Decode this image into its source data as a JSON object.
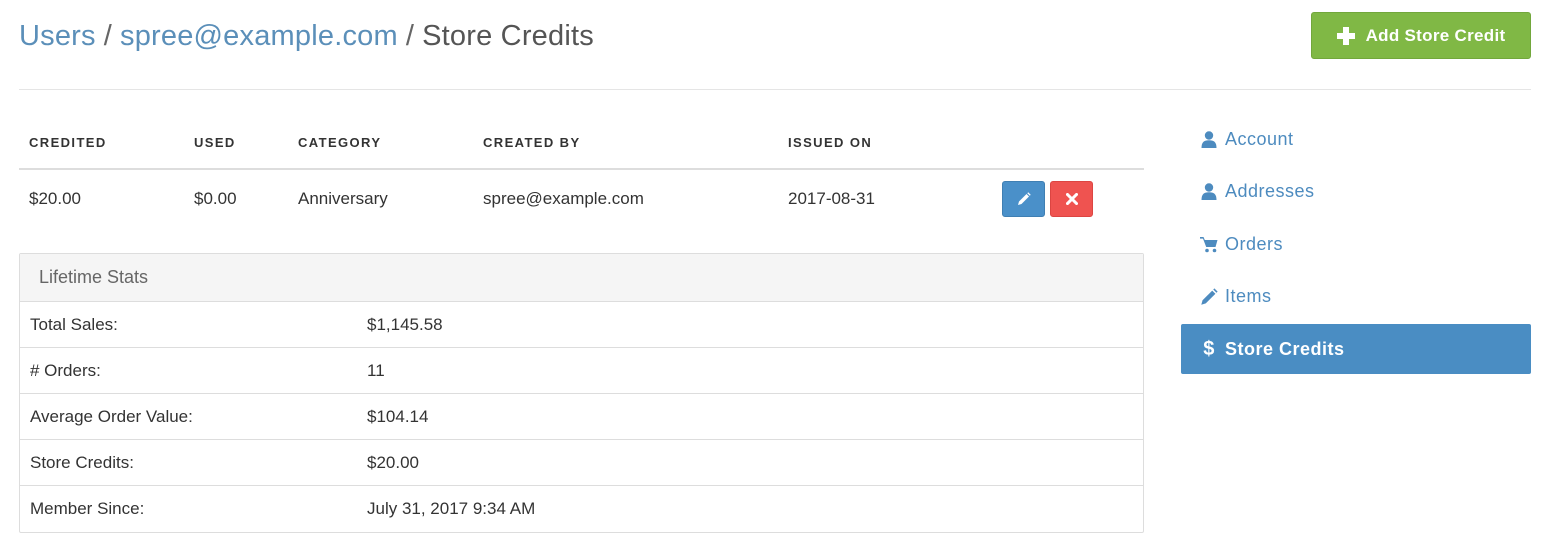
{
  "header": {
    "breadcrumb": {
      "users": "Users",
      "user_email": "spree@example.com",
      "current": "Store Credits",
      "separator": "/"
    },
    "add_button_label": "Add Store Credit"
  },
  "credits_table": {
    "headers": {
      "credited": "CREDITED",
      "used": "USED",
      "category": "CATEGORY",
      "created_by": "CREATED BY",
      "issued_on": "ISSUED ON"
    },
    "rows": [
      {
        "credited": "$20.00",
        "used": "$0.00",
        "category": "Anniversary",
        "created_by": "spree@example.com",
        "issued_on": "2017-08-31"
      }
    ]
  },
  "lifetime_stats": {
    "title": "Lifetime Stats",
    "rows": [
      {
        "label": "Total Sales:",
        "value": "$1,145.58"
      },
      {
        "label": "# Orders:",
        "value": "11"
      },
      {
        "label": "Average Order Value:",
        "value": "$104.14"
      },
      {
        "label": "Store Credits:",
        "value": "$20.00"
      },
      {
        "label": "Member Since:",
        "value": "July 31, 2017 9:34 AM"
      }
    ]
  },
  "sidebar": {
    "items": [
      {
        "label": "Account",
        "icon": "user-icon",
        "active": false
      },
      {
        "label": "Addresses",
        "icon": "user-icon",
        "active": false
      },
      {
        "label": "Orders",
        "icon": "cart-icon",
        "active": false
      },
      {
        "label": "Items",
        "icon": "pencil-icon",
        "active": false
      },
      {
        "label": "Store Credits",
        "icon": "dollar-icon",
        "glyph": "$",
        "active": true
      }
    ]
  },
  "colors": {
    "link": "#5b8fb9",
    "success": "#80b845",
    "primary": "#4a8dc3",
    "danger": "#ef5350"
  }
}
